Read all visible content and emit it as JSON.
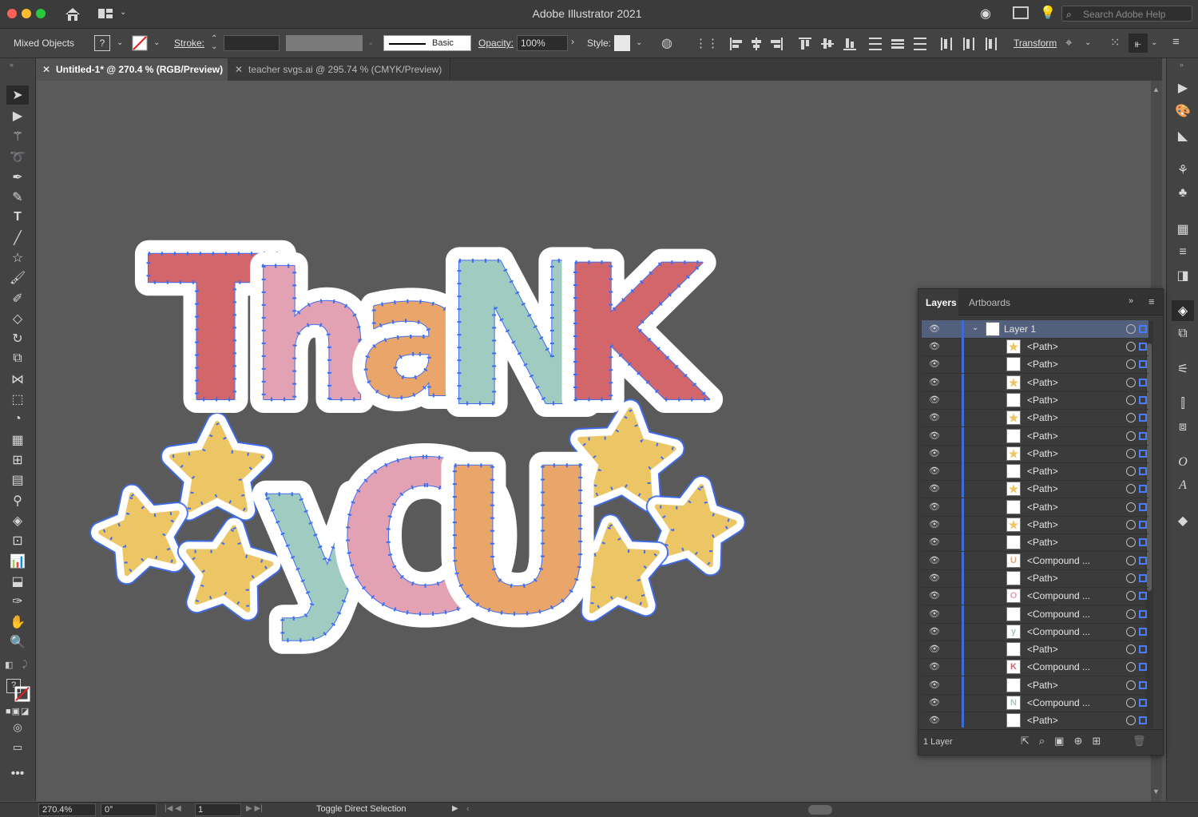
{
  "app": {
    "title": "Adobe Illustrator 2021",
    "search_placeholder": "Search Adobe Help"
  },
  "control_bar": {
    "selection": "Mixed Objects",
    "stroke_label": "Stroke:",
    "brush_label": "Basic",
    "opacity_label": "Opacity:",
    "opacity_value": "100%",
    "style_label": "Style:",
    "transform_label": "Transform"
  },
  "tabs": [
    {
      "label": "Untitled-1* @ 270.4 % (RGB/Preview)",
      "active": true
    },
    {
      "label": "teacher svgs.ai @ 295.74 % (CMYK/Preview)",
      "active": false
    }
  ],
  "artwork": {
    "line1": [
      "T",
      "h",
      "a",
      "N",
      "K"
    ],
    "line2": [
      "y",
      "O",
      "U"
    ],
    "colors": {
      "red": "#d2666a",
      "pink": "#e3a1b4",
      "orange": "#e9a56a",
      "teal": "#9fcbc0",
      "yellow": "#ecc665",
      "outline": "#ffffff",
      "path": "#3d6df2"
    }
  },
  "layers_panel": {
    "tabs": [
      "Layers",
      "Artboards"
    ],
    "layer_name": "Layer 1",
    "items": [
      {
        "name": "<Path>",
        "thumb": "star"
      },
      {
        "name": "<Path>",
        "thumb": "blank"
      },
      {
        "name": "<Path>",
        "thumb": "star"
      },
      {
        "name": "<Path>",
        "thumb": "blank"
      },
      {
        "name": "<Path>",
        "thumb": "star"
      },
      {
        "name": "<Path>",
        "thumb": "blank"
      },
      {
        "name": "<Path>",
        "thumb": "star"
      },
      {
        "name": "<Path>",
        "thumb": "blank"
      },
      {
        "name": "<Path>",
        "thumb": "star"
      },
      {
        "name": "<Path>",
        "thumb": "blank"
      },
      {
        "name": "<Path>",
        "thumb": "star"
      },
      {
        "name": "<Path>",
        "thumb": "blank"
      },
      {
        "name": "<Compound ...",
        "thumb": "U"
      },
      {
        "name": "<Path>",
        "thumb": "blank"
      },
      {
        "name": "<Compound ...",
        "thumb": "O"
      },
      {
        "name": "<Compound ...",
        "thumb": "blank"
      },
      {
        "name": "<Compound ...",
        "thumb": "y"
      },
      {
        "name": "<Path>",
        "thumb": "blank"
      },
      {
        "name": "<Compound ...",
        "thumb": "K"
      },
      {
        "name": "<Path>",
        "thumb": "blank"
      },
      {
        "name": "<Compound ...",
        "thumb": "N"
      },
      {
        "name": "<Path>",
        "thumb": "blank"
      }
    ],
    "footer": "1 Layer"
  },
  "status_bar": {
    "zoom": "270.4%",
    "rotation": "0°",
    "artboard": "1",
    "status": "Toggle Direct Selection"
  }
}
